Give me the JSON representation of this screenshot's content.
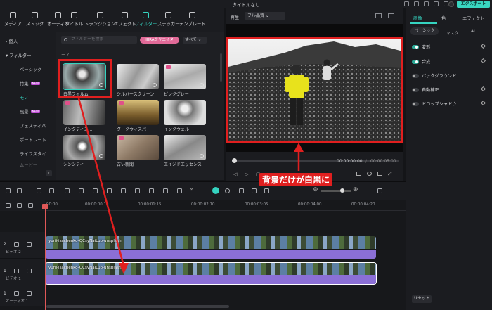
{
  "window": {
    "title": "タイトルなし",
    "export_label": "エクスポート"
  },
  "toolbar": {
    "items": [
      {
        "label": "メディア",
        "icon": "media-icon"
      },
      {
        "label": "ストック",
        "icon": "stock-icon"
      },
      {
        "label": "オーディオ",
        "icon": "music-icon"
      },
      {
        "label": "タイトル",
        "icon": "text-icon"
      },
      {
        "label": "トランジション",
        "icon": "transition-icon"
      },
      {
        "label": "エフェクト",
        "icon": "effect-icon"
      },
      {
        "label": "フィルター",
        "icon": "filter-icon",
        "active": true
      },
      {
        "label": "ステッカー",
        "icon": "sticker-icon"
      },
      {
        "label": "テンプレート",
        "icon": "template-icon"
      }
    ]
  },
  "sidebar": {
    "personal": "個人",
    "filter": "フィルター",
    "items": [
      "ベーシック",
      "特集",
      "モノ",
      "風景",
      "フェスティバ...",
      "ポートレート",
      "ライフスタイ...",
      "ムービー"
    ],
    "new_badge": "NEW"
  },
  "browser": {
    "search_placeholder": "フィルターを検索",
    "creator_label": "IIIRAクリエイタ",
    "filter_select": "すべて",
    "category": "モノ",
    "thumbs": [
      {
        "caption": "白黒フィルム"
      },
      {
        "caption": "シルバースクリーン"
      },
      {
        "caption": "ピンクグレー"
      },
      {
        "caption": "インクディス..."
      },
      {
        "caption": "ダークウィスパー"
      },
      {
        "caption": "インクウェル"
      },
      {
        "caption": "シンシティ"
      },
      {
        "caption": "古い新聞"
      },
      {
        "caption": "エイジドエッセンス"
      }
    ]
  },
  "preview": {
    "play_label": "再生",
    "quality": "フル品質",
    "current_time": "00:00:00:00",
    "separator": "/",
    "total_time": "00:00:05:00"
  },
  "properties": {
    "tabs": [
      "画像",
      "色",
      "エフェクト"
    ],
    "subtabs": [
      "ベーシック",
      "マスク",
      "AI"
    ],
    "rows": [
      {
        "label": "変形",
        "on": true
      },
      {
        "label": "合成",
        "on": true
      },
      {
        "label": "バックグラウンド",
        "on": false
      },
      {
        "label": "自動補正",
        "on": false
      },
      {
        "label": "ドロップシャドウ",
        "on": false
      }
    ],
    "reset_label": "リセット"
  },
  "timeline": {
    "ruler": [
      "00:00",
      "00:00:00:10",
      "00:00:01:15",
      "00:00:02:10",
      "00:00:03:05",
      "00:00:04:00",
      "00:00:04:20"
    ],
    "tracks": [
      {
        "name": "ビデオ 2",
        "num": "2",
        "clip": "yurii-isachenko-QCsyNaiLuo-unsplash"
      },
      {
        "name": "ビデオ 1",
        "num": "1",
        "clip": "yurii-isachenko-QCsyNaiLuo-unsplash"
      },
      {
        "name": "オーディオ 1",
        "num": "1"
      }
    ]
  },
  "annotation": {
    "text": "背景だけが白黒に",
    "color": "#e01f1f"
  }
}
